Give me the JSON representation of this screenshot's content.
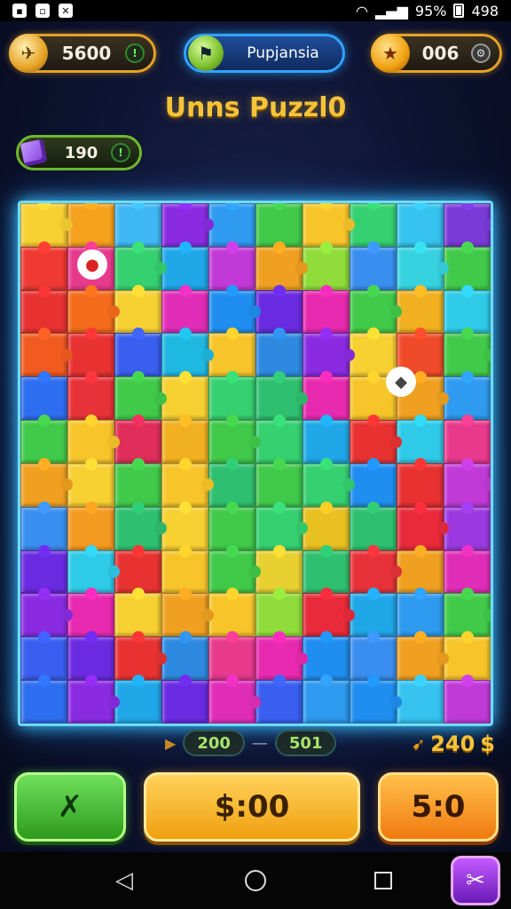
{
  "status_bar": {
    "battery": "95%",
    "time": "498"
  },
  "hud": {
    "coins": "5600",
    "mode_label": "Pupjansia",
    "gems": "006",
    "blocks": "190"
  },
  "title": "Unns Puzzl0",
  "progress": {
    "current": "200",
    "target": "501",
    "score": "240"
  },
  "buttons": {
    "tool": "",
    "buy": "$:00",
    "alt": "5:0"
  },
  "board": {
    "columns": 10,
    "rows": 12,
    "colors": [
      "#f7d032",
      "#f4a21c",
      "#3fb8f5",
      "#8a2be2",
      "#2e9af0",
      "#41c94a",
      "#f7c52a",
      "#35d070",
      "#36c3f0",
      "#7a3ad8",
      "#ee3a32",
      "#e83a8c",
      "#35d070",
      "#1fa7e8",
      "#c13ad8",
      "#f0a020",
      "#8fdc3a",
      "#3a8ef0",
      "#36d2e0",
      "#41c94a",
      "#e83232",
      "#f56b1c",
      "#f7d032",
      "#e02db8",
      "#1f8ef0",
      "#6a2ae0",
      "#e82ab0",
      "#41c94a",
      "#f0b020",
      "#2ecae8",
      "#f25b20",
      "#e83232",
      "#3a5ef0",
      "#1fb8e0",
      "#f7c52a",
      "#2e8ae0",
      "#8a2be2",
      "#f7d032",
      "#ef4a2a",
      "#41c94a",
      "#2e6ef0",
      "#e8323a",
      "#41c94a",
      "#f7d032",
      "#35d070",
      "#2ec070",
      "#e82ab0",
      "#f7c52a",
      "#f0a020",
      "#2e9af0",
      "#41c94a",
      "#f7c52a",
      "#e02d5a",
      "#f0b020",
      "#41c94a",
      "#35d070",
      "#1fa7e8",
      "#e83232",
      "#2ecae8",
      "#e83a8c",
      "#f0a020",
      "#f7d032",
      "#41c94a",
      "#f7c52a",
      "#2ec070",
      "#41c94a",
      "#35d070",
      "#1f8ef0",
      "#e83232",
      "#c13ad8",
      "#3a8ef0",
      "#f59a20",
      "#2ec070",
      "#f7d032",
      "#41c94a",
      "#35d070",
      "#e8c020",
      "#2ec070",
      "#e82a3a",
      "#9a3ae0",
      "#6a2ae0",
      "#2ecae8",
      "#e83232",
      "#f7c52a",
      "#41c94a",
      "#e8d030",
      "#2ec070",
      "#e8323a",
      "#f0a020",
      "#e02db8",
      "#8a2be2",
      "#e82ab0",
      "#f7d032",
      "#f0a020",
      "#f7c52a",
      "#8fdc3a",
      "#e82a3a",
      "#1fa7e8",
      "#2e9af0",
      "#41c94a",
      "#3a5ef0",
      "#6a2ae0",
      "#e83232",
      "#2e8ae0",
      "#e83a8c",
      "#e82ab0",
      "#1f8ef0",
      "#3a8ef0",
      "#f0a020",
      "#f7c52a",
      "#2e6ef0",
      "#8a2be2",
      "#1fa7e8",
      "#6a2ae0",
      "#e02db8",
      "#3a5ef0",
      "#2e9af0",
      "#1f8ef0",
      "#36c3f0",
      "#c13ad8"
    ]
  }
}
